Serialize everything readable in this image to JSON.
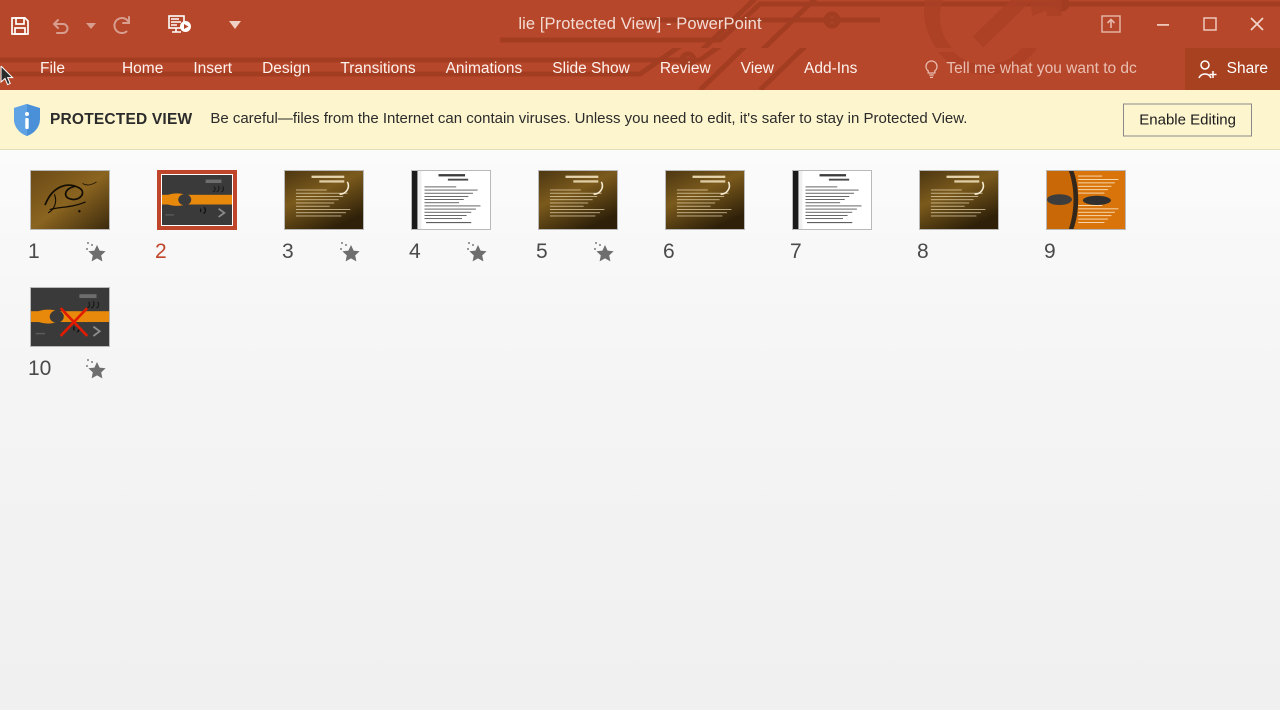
{
  "window": {
    "title": "lie [Protected View] - PowerPoint",
    "accent_color": "#b7472a",
    "share_bg_color": "#a8411f"
  },
  "quick_access": {
    "items": [
      {
        "name": "save-button",
        "icon": "save-icon",
        "label": "Save",
        "enabled": true
      },
      {
        "name": "undo-button",
        "icon": "undo-icon",
        "label": "Undo",
        "enabled": false
      },
      {
        "name": "undo-dropdown",
        "icon": "chevron-down-icon",
        "label": "Undo options",
        "enabled": false
      },
      {
        "name": "redo-button",
        "icon": "redo-icon",
        "label": "Redo",
        "enabled": false
      },
      {
        "name": "start-presentation-button",
        "icon": "start-slideshow-icon",
        "label": "Start From Beginning",
        "enabled": true
      },
      {
        "name": "customize-qat-button",
        "icon": "chevron-down-icon",
        "label": "Customize Quick Access Toolbar",
        "enabled": true
      }
    ]
  },
  "window_controls": [
    {
      "name": "ribbon-display-options-button",
      "icon": "ribbon-display-icon",
      "label": "Ribbon Display Options"
    },
    {
      "name": "minimize-button",
      "icon": "minimize-icon",
      "label": "Minimize"
    },
    {
      "name": "restore-button",
      "icon": "restore-icon",
      "label": "Restore Down"
    },
    {
      "name": "close-button",
      "icon": "close-icon",
      "label": "Close"
    }
  ],
  "ribbon": {
    "tabs": [
      {
        "id": "file",
        "label": "File"
      },
      {
        "id": "home",
        "label": "Home"
      },
      {
        "id": "insert",
        "label": "Insert"
      },
      {
        "id": "design",
        "label": "Design"
      },
      {
        "id": "transitions",
        "label": "Transitions"
      },
      {
        "id": "animations",
        "label": "Animations"
      },
      {
        "id": "slideshow",
        "label": "Slide Show"
      },
      {
        "id": "review",
        "label": "Review"
      },
      {
        "id": "view",
        "label": "View"
      },
      {
        "id": "addins",
        "label": "Add-Ins"
      }
    ],
    "tell_me": {
      "icon": "lightbulb-icon",
      "text": "Tell me what you want to dc"
    },
    "share": {
      "icon": "share-person-icon",
      "label": "Share"
    }
  },
  "protected_view": {
    "icon": "info-shield-icon",
    "label": "PROTECTED VIEW",
    "message": "Be careful—files from the Internet can contain viruses. Unless you need to edit, it's safer to stay in Protected View.",
    "button_label": "Enable Editing",
    "bg_color": "#fdf5ce"
  },
  "slides": [
    {
      "number": "1",
      "selected": false,
      "has_animation": true,
      "style": "calligraphy-brown"
    },
    {
      "number": "2",
      "selected": true,
      "has_animation": false,
      "style": "dark-orange-bars"
    },
    {
      "number": "3",
      "selected": false,
      "has_animation": true,
      "style": "brown-text"
    },
    {
      "number": "4",
      "selected": false,
      "has_animation": true,
      "style": "white-text"
    },
    {
      "number": "5",
      "selected": false,
      "has_animation": true,
      "style": "brown-text"
    },
    {
      "number": "6",
      "selected": false,
      "has_animation": false,
      "style": "brown-text"
    },
    {
      "number": "7",
      "selected": false,
      "has_animation": false,
      "style": "white-text"
    },
    {
      "number": "8",
      "selected": false,
      "has_animation": false,
      "style": "brown-text"
    },
    {
      "number": "9",
      "selected": false,
      "has_animation": false,
      "style": "orange-split"
    },
    {
      "number": "10",
      "selected": false,
      "has_animation": true,
      "style": "dark-orange-bars-x"
    }
  ]
}
